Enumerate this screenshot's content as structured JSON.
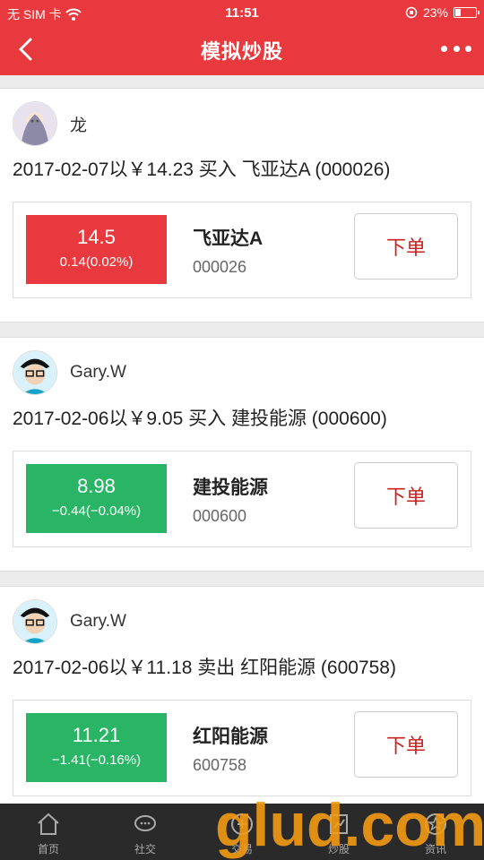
{
  "status": {
    "carrier": "无 SIM 卡",
    "time": "11:51",
    "battery": "23%",
    "battery_level": 0.23
  },
  "nav": {
    "title": "模拟炒股"
  },
  "posts": [
    {
      "user": "龙",
      "desc": "2017-02-07以￥14.23 买入 飞亚达A (000026)",
      "price": "14.5",
      "change": "0.14(0.02%)",
      "direction": "up",
      "name": "飞亚达A",
      "code": "000026",
      "action": "下单"
    },
    {
      "user": "Gary.W",
      "desc": "2017-02-06以￥9.05 买入 建投能源 (000600)",
      "price": "8.98",
      "change": "−0.44(−0.04%)",
      "direction": "down",
      "name": "建投能源",
      "code": "000600",
      "action": "下单"
    },
    {
      "user": "Gary.W",
      "desc": "2017-02-06以￥11.18 卖出 红阳能源 (600758)",
      "price": "11.21",
      "change": "−1.41(−0.16%)",
      "direction": "down",
      "name": "红阳能源",
      "code": "600758",
      "action": "下单"
    }
  ],
  "tabs": [
    {
      "label": "首页",
      "icon": "home-icon"
    },
    {
      "label": "社交",
      "icon": "chat-icon"
    },
    {
      "label": "交易",
      "icon": "trade-icon"
    },
    {
      "label": "炒股",
      "icon": "stock-icon"
    },
    {
      "label": "资讯",
      "icon": "star-icon"
    }
  ],
  "watermark": {
    "main": "glud",
    "suffix": ".com"
  }
}
